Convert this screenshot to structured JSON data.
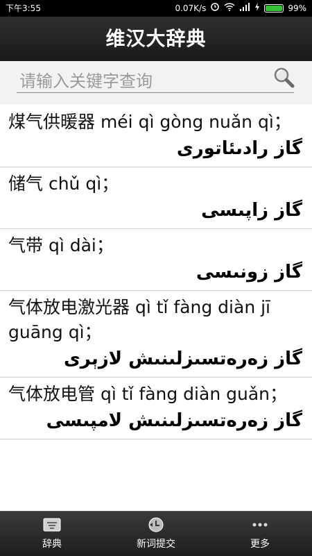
{
  "status_bar": {
    "time": "下午3:55",
    "speed": "0.07K/s",
    "battery": "99%",
    "battery_level": 0.99
  },
  "app": {
    "title": "维汉大辞典"
  },
  "search": {
    "placeholder": "请输入关键字查询"
  },
  "entries": [
    {
      "zh": "煤气供暖器 méi qì gòng nuǎn qì；",
      "ug": "گاز رادىئاتورى"
    },
    {
      "zh": "储气 chǔ qì；",
      "ug": "گاز زاپىسى"
    },
    {
      "zh": "气带 qì dài；",
      "ug": "گاز زونىسى"
    },
    {
      "zh": "气体放电激光器 qì tǐ fàng diàn jī guāng qì；",
      "ug": "گاز زەرەتسىزلىنىش لازېرى"
    },
    {
      "zh": "气体放电管 qì tǐ fàng diàn guǎn；",
      "ug": "گاز زەرەتسىزلىنىش لامپىسى"
    }
  ],
  "tabs": [
    {
      "label": "辞典",
      "icon": "dictionary-icon"
    },
    {
      "label": "新词提交",
      "icon": "submit-word-icon"
    },
    {
      "label": "更多",
      "icon": "more-icon"
    }
  ],
  "colors": {
    "title_bg": "#222222",
    "battery_green": "#35c336"
  }
}
